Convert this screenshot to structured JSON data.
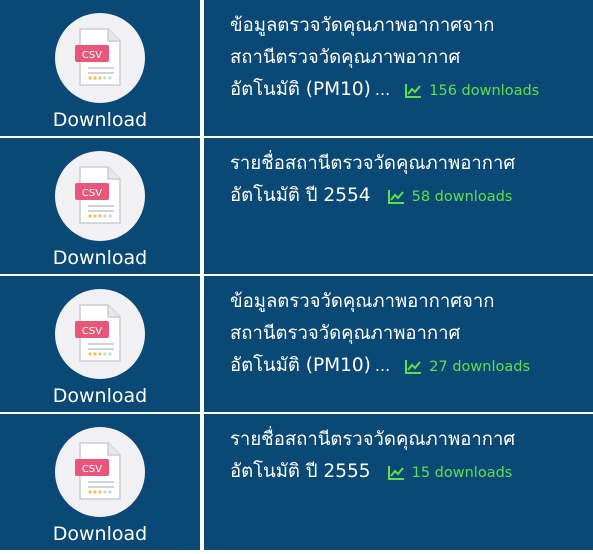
{
  "colors": {
    "row_bg": "#0a4876",
    "accent_green": "#5ee04a",
    "icon_circle": "#f1f1f3",
    "csv_badge": "#e8577a"
  },
  "items": [
    {
      "icon": "csv-file-icon",
      "csv_text": "CSV",
      "download_label": "Download",
      "title_lines": [
        "ข้อมูลตรวจวัดคุณภาพอากาศจาก",
        "สถานีตรวจวัดคุณภาพอากาศ",
        "อัตโนมัติ (PM10)"
      ],
      "truncated": "...",
      "downloads": "156 downloads"
    },
    {
      "icon": "csv-file-icon",
      "csv_text": "CSV",
      "download_label": "Download",
      "title_lines": [
        "รายชื่อสถานีตรวจวัดคุณภาพอากาศ",
        "อัตโนมัติ ปี 2554"
      ],
      "truncated": "",
      "downloads": "58 downloads"
    },
    {
      "icon": "csv-file-icon",
      "csv_text": "CSV",
      "download_label": "Download",
      "title_lines": [
        "ข้อมูลตรวจวัดคุณภาพอากาศจาก",
        "สถานีตรวจวัดคุณภาพอากาศ",
        "อัตโนมัติ (PM10)"
      ],
      "truncated": "...",
      "downloads": "27 downloads"
    },
    {
      "icon": "csv-file-icon",
      "csv_text": "CSV",
      "download_label": "Download",
      "title_lines": [
        "รายชื่อสถานีตรวจวัดคุณภาพอากาศ",
        "อัตโนมัติ ปี 2555"
      ],
      "truncated": "",
      "downloads": "15 downloads"
    }
  ]
}
